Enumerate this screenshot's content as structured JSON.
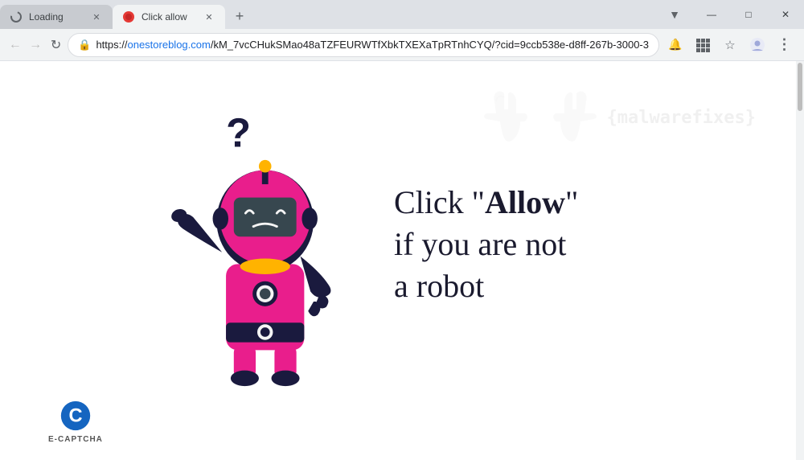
{
  "browser": {
    "tabs": [
      {
        "id": "tab-loading",
        "label": "Loading",
        "active": false,
        "favicon": "loading"
      },
      {
        "id": "tab-click-allow",
        "label": "Click allow",
        "active": true,
        "favicon": "red-circle"
      }
    ],
    "new_tab_label": "+",
    "window_controls": {
      "minimize": "—",
      "maximize": "□",
      "close": "✕"
    }
  },
  "toolbar": {
    "back_label": "←",
    "forward_label": "→",
    "reload_label": "↻",
    "address": {
      "protocol": "https://",
      "domain": "onestoreblog.com",
      "path": "/kM_7vcCHukSMao48aTZFEURWTfXbkTXEXaTpRTnhCYQ/?cid=9ccb538e-d8ff-267b-3000-3"
    },
    "notifications_icon": "🔔",
    "apps_icon": "⊞",
    "bookmark_icon": "☆",
    "profile_icon": "👤",
    "menu_icon": "⋮"
  },
  "page": {
    "watermark": {
      "text": "{malwarefixes}",
      "alt": "malwarefixes watermark"
    },
    "message": {
      "line1": "Click \"",
      "bold": "Allow",
      "line1_end": "\"",
      "line2": "if you are not",
      "line3": "a robot"
    },
    "ecaptcha": {
      "label": "E-CAPTCHA"
    },
    "robot": {
      "alt": "confused robot illustration"
    }
  }
}
